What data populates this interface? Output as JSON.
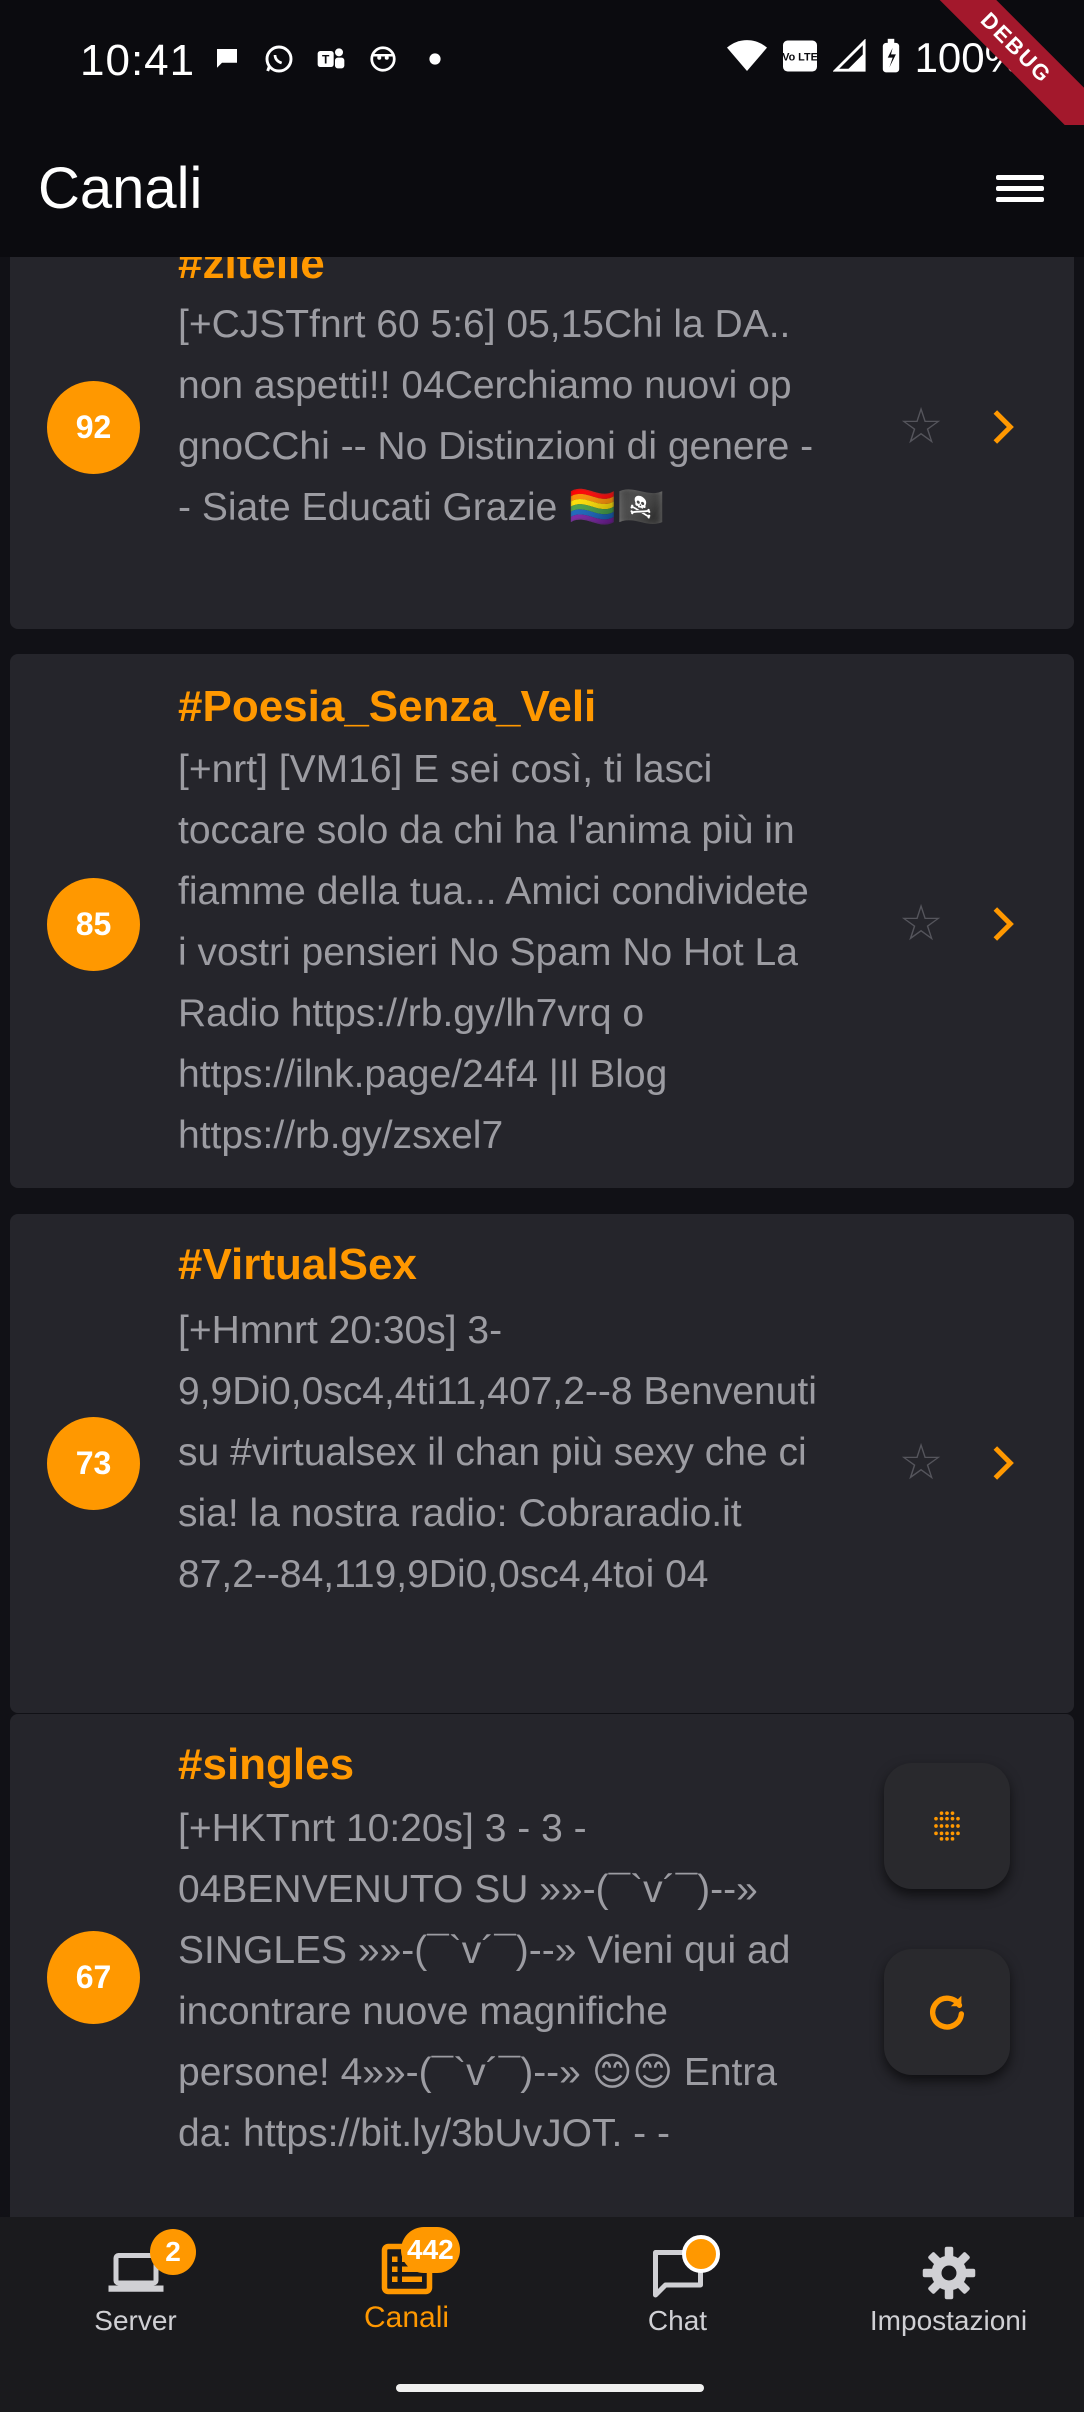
{
  "status_bar": {
    "time": "10:41",
    "battery": "100%",
    "volte_label": "Vo LTE",
    "debug_label": "DEBUG",
    "left_icons": [
      "chat-bubble-icon",
      "whatsapp-icon",
      "teams-icon",
      "app-icon",
      "dot-icon"
    ],
    "right_icons": [
      "wifi-icon",
      "volte-icon",
      "signal-icon",
      "battery-icon"
    ]
  },
  "app_bar": {
    "title": "Canali",
    "menu_icon": "menu-icon"
  },
  "channels": [
    {
      "count": "92",
      "name": "#zitelle",
      "topic": "[+CJSTfnrt 60 5:6] 05,15Chi la DA.. non aspetti!! 04Cerchiamo nuovi op gnoCChi -- No Distinzioni di genere -- Siate Educati Grazie 🏳️‍🌈🏴‍☠️",
      "favorite_icon": "star-outline-icon",
      "open_icon": "chevron-right-icon"
    },
    {
      "count": "85",
      "name": "#Poesia_Senza_Veli",
      "topic": "[+nrt] [VM16] E sei così, ti lasci toccare solo da chi ha l'anima più in fiamme della tua... Amici condividete i vostri pensieri No Spam No Hot La Radio https://rb.gy/lh7vrq o https://ilnk.page/24f4 |Il Blog https://rb.gy/zsxel7",
      "favorite_icon": "star-outline-icon",
      "open_icon": "chevron-right-icon"
    },
    {
      "count": "73",
      "name": "#VirtualSex",
      "topic": "[+Hmnrt 20:30s] 3-9,9Di0,0sc4,4ti11,407,2--8 Benvenuti su #virtualsex il chan più sexy che ci sia! la nostra radio: Cobraradio.it 87,2--84,119,9Di0,0sc4,4toi 04",
      "favorite_icon": "star-outline-icon",
      "open_icon": "chevron-right-icon"
    },
    {
      "count": "67",
      "name": "#singles",
      "topic": "[+HKTnrt 10:20s]   3 - 3 - 04BENVENUTO SU »»-(¯`v´¯)--» SINGLES »»-(¯`v´¯)--»  Vieni qui ad incontrare nuove magnifiche persone!  4»»-(¯`v´¯)--» 😊😊 Entra  da: https://bit.ly/3bUvJOT. - -",
      "favorite_icon": "star-outline-icon",
      "open_icon": "chevron-right-icon"
    }
  ],
  "fabs": {
    "filter_icon": "dots-grid-icon",
    "refresh_icon": "refresh-icon"
  },
  "bottom_nav": {
    "items": [
      {
        "label": "Server",
        "icon": "laptop-icon",
        "badge": "2",
        "active": false
      },
      {
        "label": "Canali",
        "icon": "list-icon",
        "badge": "442",
        "active": true
      },
      {
        "label": "Chat",
        "icon": "chat-icon",
        "badge": "",
        "active": false
      },
      {
        "label": "Impostazioni",
        "icon": "gear-icon",
        "badge": "",
        "active": false
      }
    ]
  },
  "colors": {
    "accent": "#ff9800",
    "background": "#0b0b0f",
    "card": "#25252b",
    "topic_text": "#9c9ca2"
  }
}
